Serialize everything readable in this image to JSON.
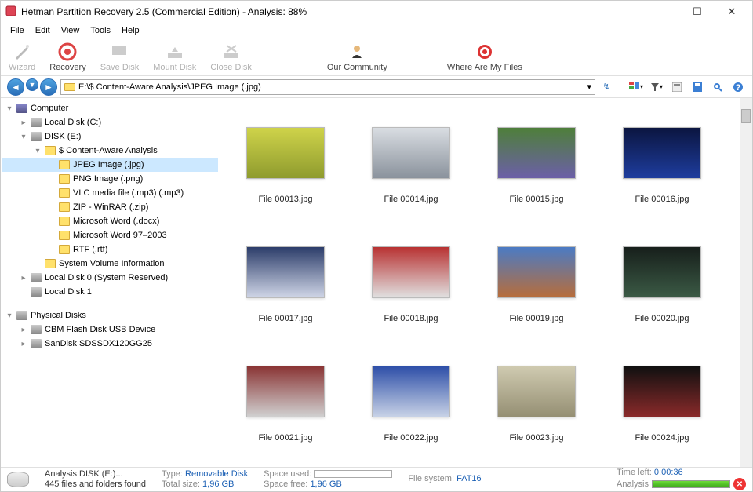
{
  "title": "Hetman Partition Recovery 2.5 (Commercial Edition) - Analysis: 88%",
  "menu": [
    "File",
    "Edit",
    "View",
    "Tools",
    "Help"
  ],
  "toolbar": [
    {
      "label": "Wizard",
      "disabled": true
    },
    {
      "label": "Recovery",
      "disabled": false
    },
    {
      "label": "Save Disk",
      "disabled": true
    },
    {
      "label": "Mount Disk",
      "disabled": true
    },
    {
      "label": "Close Disk",
      "disabled": true
    },
    {
      "label": "Our Community",
      "disabled": false
    },
    {
      "label": "Where Are My Files",
      "disabled": false
    }
  ],
  "path": "E:\\$ Content-Aware Analysis\\JPEG Image (.jpg)",
  "tree": [
    {
      "d": 0,
      "exp": "▾",
      "ic": "computer",
      "label": "Computer"
    },
    {
      "d": 1,
      "exp": "▸",
      "ic": "disk",
      "label": "Local Disk (C:)"
    },
    {
      "d": 1,
      "exp": "▾",
      "ic": "disk",
      "label": "DISK (E:)"
    },
    {
      "d": 2,
      "exp": "▾",
      "ic": "folder",
      "label": "$ Content-Aware Analysis"
    },
    {
      "d": 3,
      "exp": "",
      "ic": "folder",
      "label": "JPEG Image (.jpg)",
      "sel": true
    },
    {
      "d": 3,
      "exp": "",
      "ic": "folder",
      "label": "PNG Image (.png)"
    },
    {
      "d": 3,
      "exp": "",
      "ic": "folder",
      "label": "VLC media file (.mp3) (.mp3)"
    },
    {
      "d": 3,
      "exp": "",
      "ic": "folder",
      "label": "ZIP - WinRAR (.zip)"
    },
    {
      "d": 3,
      "exp": "",
      "ic": "folder",
      "label": "Microsoft Word (.docx)"
    },
    {
      "d": 3,
      "exp": "",
      "ic": "folder",
      "label": "Microsoft Word 97–2003"
    },
    {
      "d": 3,
      "exp": "",
      "ic": "folder",
      "label": "RTF (.rtf)"
    },
    {
      "d": 2,
      "exp": "",
      "ic": "folder",
      "label": "System Volume Information"
    },
    {
      "d": 1,
      "exp": "▸",
      "ic": "disk",
      "label": "Local Disk 0 (System Reserved)"
    },
    {
      "d": 1,
      "exp": "",
      "ic": "disk",
      "label": "Local Disk 1"
    },
    {
      "d": -1,
      "spacer": true
    },
    {
      "d": 0,
      "exp": "▾",
      "ic": "disk",
      "label": "Physical Disks"
    },
    {
      "d": 1,
      "exp": "▸",
      "ic": "disk",
      "label": "CBM Flash Disk USB Device"
    },
    {
      "d": 1,
      "exp": "▸",
      "ic": "disk",
      "label": "SanDisk SDSSDX120GG25"
    }
  ],
  "thumbs": [
    {
      "name": "File 00013.jpg",
      "bg": "linear-gradient(#cfd34a, #8f9b2e)"
    },
    {
      "name": "File 00014.jpg",
      "bg": "linear-gradient(#d9dde2, #8a929c)"
    },
    {
      "name": "File 00015.jpg",
      "bg": "linear-gradient(#4e7f3a, #6c5fa8)"
    },
    {
      "name": "File 00016.jpg",
      "bg": "linear-gradient(#0b1540, #1e3d9e)"
    },
    {
      "name": "File 00017.jpg",
      "bg": "linear-gradient(#2c3d6a, #cfd5e6)"
    },
    {
      "name": "File 00018.jpg",
      "bg": "linear-gradient(#b83232, #e0e0e0)"
    },
    {
      "name": "File 00019.jpg",
      "bg": "linear-gradient(#4b7bc4, #b86d3a)"
    },
    {
      "name": "File 00020.jpg",
      "bg": "linear-gradient(#171f1b, #3b5a45)"
    },
    {
      "name": "File 00021.jpg",
      "bg": "linear-gradient(#8a3535, #d0d0d0)"
    },
    {
      "name": "File 00022.jpg",
      "bg": "linear-gradient(#2e4fa8, #c8d2e6)"
    },
    {
      "name": "File 00023.jpg",
      "bg": "linear-gradient(#cfcab0, #958f73)"
    },
    {
      "name": "File 00024.jpg",
      "bg": "linear-gradient(#101010, #8a2a2a)"
    }
  ],
  "status": {
    "disk_line": "Analysis DISK (E:)...",
    "found": "445 files and folders found",
    "type_label": "Type:",
    "type_val": "Removable Disk",
    "total_label": "Total size:",
    "total_val": "1,96 GB",
    "used_label": "Space used:",
    "free_label": "Space free:",
    "free_val": "1,96 GB",
    "fs_label": "File system:",
    "fs_val": "FAT16",
    "time_label": "Time left:",
    "time_val": "0:00:36",
    "analysis_label": "Analysis"
  }
}
